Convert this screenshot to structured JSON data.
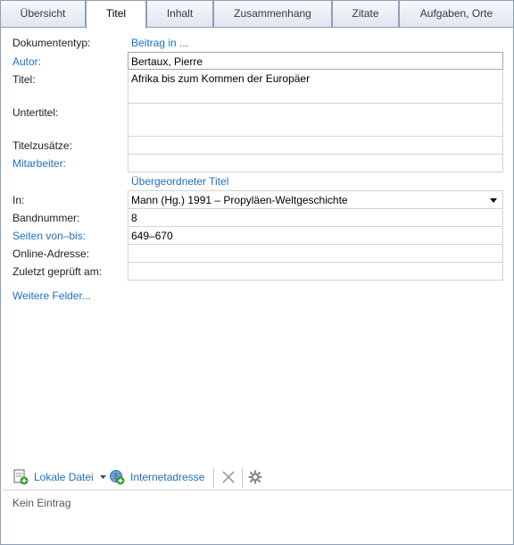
{
  "tabs": [
    {
      "label": "Übersicht"
    },
    {
      "label": "Titel"
    },
    {
      "label": "Inhalt"
    },
    {
      "label": "Zusammenhang"
    },
    {
      "label": "Zitate"
    },
    {
      "label": "Aufgaben, Orte"
    }
  ],
  "form": {
    "dokumententyp_label": "Dokumententyp:",
    "dokumententyp_value": "Beitrag in ...",
    "autor_label": "Autor:",
    "autor_value": "Bertaux, Pierre",
    "titel_label": "Titel:",
    "titel_value": "Afrika bis zum Kommen der Europäer",
    "untertitel_label": "Untertitel:",
    "untertitel_value": "",
    "titelzusaetze_label": "Titelzusätze:",
    "titelzusaetze_value": "",
    "mitarbeiter_label": "Mitarbeiter:",
    "mitarbeiter_value": "",
    "parent_header": "Übergeordneter Titel",
    "in_label": "In:",
    "in_value": "Mann (Hg.) 1991 – Propyläen-Weltgeschichte",
    "bandnummer_label": "Bandnummer:",
    "bandnummer_value": "8",
    "seiten_label": "Seiten von–bis:",
    "seiten_value": "649–670",
    "online_label": "Online-Adresse:",
    "online_value": "",
    "geprueft_label": "Zuletzt geprüft am:",
    "geprueft_value": "",
    "weitere_felder": "Weitere Felder..."
  },
  "toolbar": {
    "lokale_datei": "Lokale Datei",
    "internetadresse": "Internetadresse"
  },
  "status": {
    "empty_text": "Kein Eintrag"
  }
}
